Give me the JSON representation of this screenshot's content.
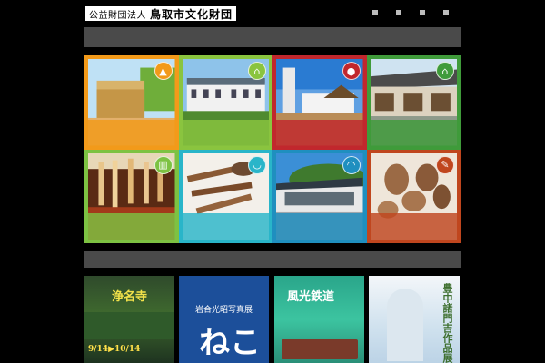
{
  "header": {
    "org_small": "公益財団法人",
    "org_big": "鳥取市文化財団"
  },
  "colors": {
    "orange": "#f29a1a",
    "green": "#8ac43f",
    "red": "#c1272d",
    "darkgreen": "#3f9b3a",
    "lightgreen": "#7dc242",
    "cyan": "#29b5c9",
    "blue": "#1f8fbf",
    "rust": "#c0461e"
  },
  "tiles": [
    {
      "icon": "mountain-icon",
      "glyph": "▲"
    },
    {
      "icon": "building-icon",
      "glyph": "⌂"
    },
    {
      "icon": "person-icon",
      "glyph": "●"
    },
    {
      "icon": "house-icon",
      "glyph": "⌂"
    },
    {
      "icon": "gallery-icon",
      "glyph": "▥"
    },
    {
      "icon": "pot-icon",
      "glyph": "◡"
    },
    {
      "icon": "hat-icon",
      "glyph": "◠"
    },
    {
      "icon": "tool-icon",
      "glyph": "✎"
    }
  ],
  "posters": [
    {
      "title": "浄名寺",
      "date": "9/14▶10/14"
    },
    {
      "caption": "岩合光昭写真展",
      "main": "ねこ"
    },
    {
      "title": "風光鉄道"
    },
    {
      "title": "豊中諸門吉作品展"
    }
  ]
}
